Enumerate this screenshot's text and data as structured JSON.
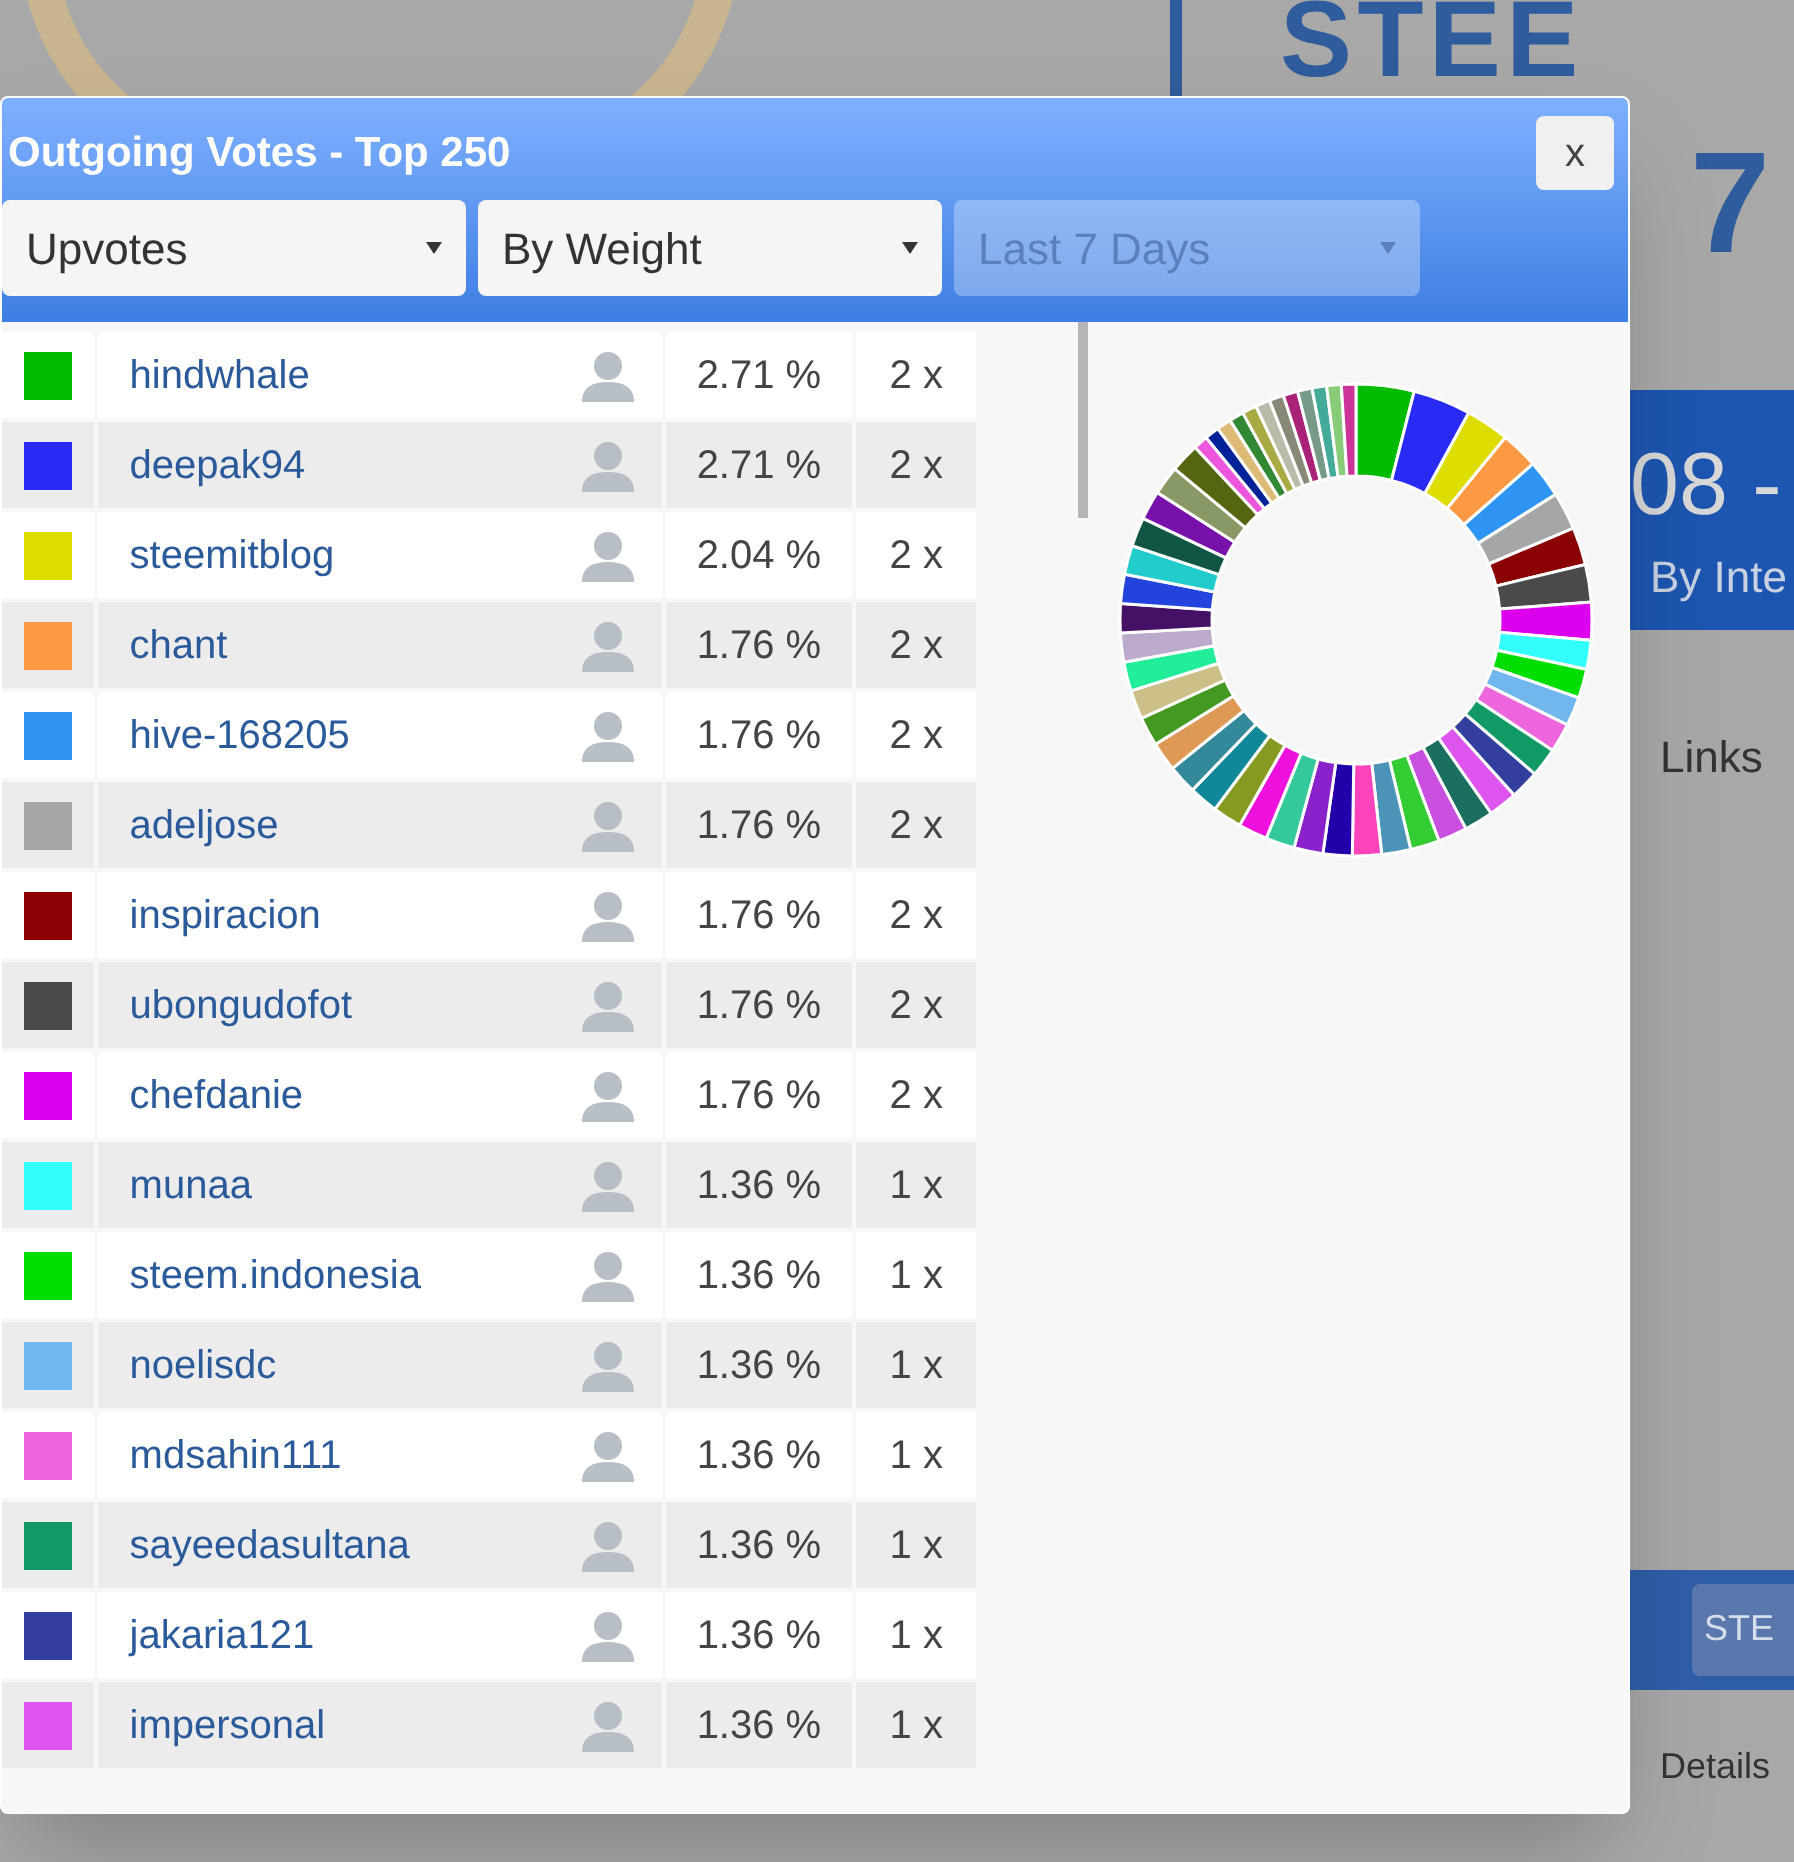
{
  "background": {
    "texts": [
      {
        "kind": "logo",
        "text": "STEE"
      },
      {
        "kind": "logo2",
        "text": "7"
      },
      {
        "kind": "banner",
        "text": "08 -"
      },
      {
        "kind": "banner_sub",
        "text": "By Inte"
      },
      {
        "kind": "tab",
        "text": "Links"
      },
      {
        "kind": "button",
        "text": "STE"
      },
      {
        "kind": "label",
        "text": "Details"
      }
    ]
  },
  "dialog": {
    "title": "Outgoing Votes - Top 250",
    "close": "x",
    "filters": [
      {
        "value": "Upvotes",
        "disabled": false
      },
      {
        "value": "By Weight",
        "disabled": false
      },
      {
        "value": "Last 7 Days",
        "disabled": true
      }
    ],
    "rows": [
      {
        "name": "hindwhale",
        "color": "#00bb00",
        "percent": "2.71 %",
        "count": "2 x"
      },
      {
        "name": "deepak94",
        "color": "#2a2af5",
        "percent": "2.71 %",
        "count": "2 x"
      },
      {
        "name": "steemitblog",
        "color": "#dddd00",
        "percent": "2.04 %",
        "count": "2 x"
      },
      {
        "name": "chant",
        "color": "#ff9944",
        "percent": "1.76 %",
        "count": "2 x"
      },
      {
        "name": "hive-168205",
        "color": "#2e95f5",
        "percent": "1.76 %",
        "count": "2 x"
      },
      {
        "name": "adeljose",
        "color": "#a6a6a6",
        "percent": "1.76 %",
        "count": "2 x"
      },
      {
        "name": "inspiracion",
        "color": "#8b0000",
        "percent": "1.76 %",
        "count": "2 x"
      },
      {
        "name": "ubongudofot",
        "color": "#4a4a4a",
        "percent": "1.76 %",
        "count": "2 x"
      },
      {
        "name": "chefdanie",
        "color": "#dd00ee",
        "percent": "1.76 %",
        "count": "2 x"
      },
      {
        "name": "munaa",
        "color": "#33ffff",
        "percent": "1.36 %",
        "count": "1 x"
      },
      {
        "name": "steem.indonesia",
        "color": "#00dd00",
        "percent": "1.36 %",
        "count": "1 x"
      },
      {
        "name": "noelisdc",
        "color": "#6fb7ee",
        "percent": "1.36 %",
        "count": "1 x"
      },
      {
        "name": "mdsahin111",
        "color": "#ee66dd",
        "percent": "1.36 %",
        "count": "1 x"
      },
      {
        "name": "sayeedasultana",
        "color": "#119966",
        "percent": "1.36 %",
        "count": "1 x"
      },
      {
        "name": "jakaria121",
        "color": "#333f9f",
        "percent": "1.36 %",
        "count": "1 x"
      },
      {
        "name": "impersonal",
        "color": "#dd55ee",
        "percent": "1.36 %",
        "count": "1 x"
      }
    ]
  }
}
